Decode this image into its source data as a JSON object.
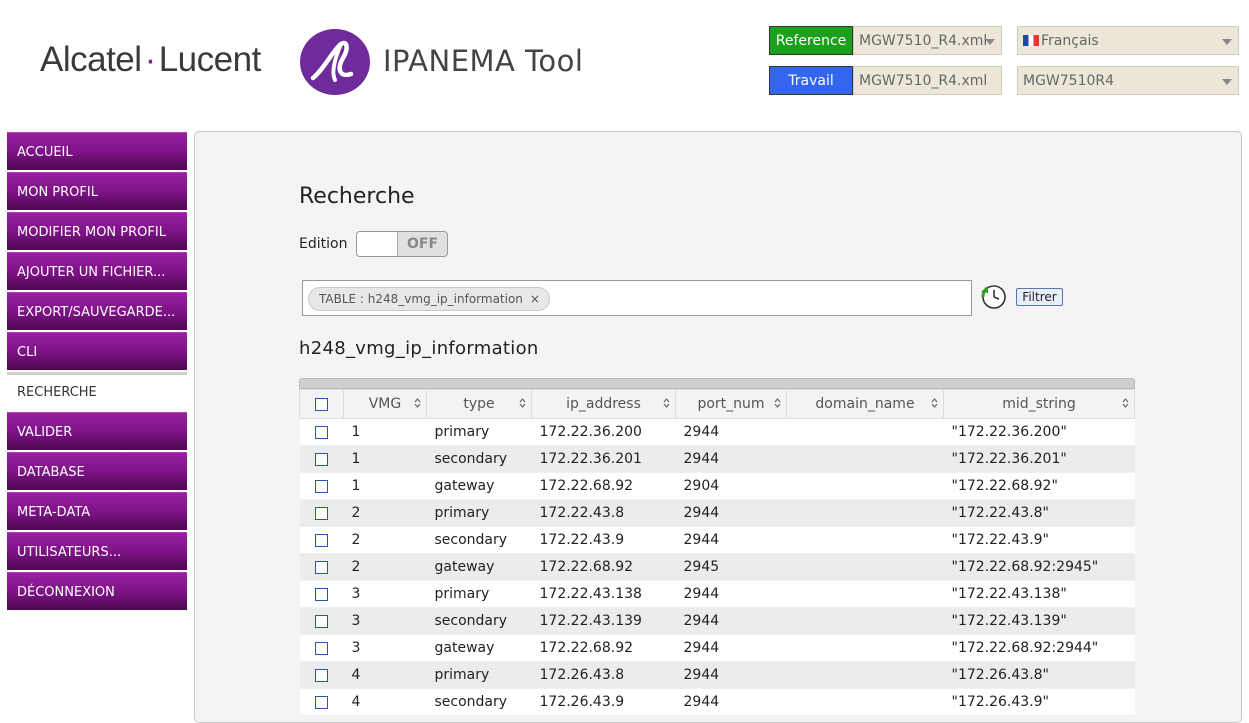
{
  "header": {
    "brand_left": "Alcatel",
    "brand_dot": "·",
    "brand_right": "Lucent",
    "tool_name": "IPANEMA Tool",
    "reference_label": "Reference",
    "reference_value": "MGW7510_R4.xml",
    "work_label": "Travail",
    "work_file": "MGW7510_R4.xml",
    "language_value": "Français",
    "work_select_value": "MGW7510R4",
    "colors": {
      "reference_bg": "#1aa01a",
      "work_bg": "#3366ee",
      "accent": "#7b2a8e"
    }
  },
  "sidebar": {
    "items": [
      {
        "label": "ACCUEIL"
      },
      {
        "label": "MON PROFIL"
      },
      {
        "label": "MODIFIER MON PROFIL"
      },
      {
        "label": "AJOUTER UN FICHIER..."
      },
      {
        "label": "EXPORT/SAUVEGARDE..."
      },
      {
        "label": "CLI"
      },
      {
        "label": "RECHERCHE"
      },
      {
        "label": "VALIDER"
      },
      {
        "label": "DATABASE"
      },
      {
        "label": "META-DATA"
      },
      {
        "label": "UTILISATEURS..."
      },
      {
        "label": "DÉCONNEXION"
      }
    ],
    "active": "RECHERCHE"
  },
  "main": {
    "title": "Recherche",
    "edition_label": "Edition",
    "edition_state": "OFF",
    "filter_chip": "TABLE : h248_vmg_ip_information",
    "filter_chip_remove": "×",
    "filter_button": "Filtrer",
    "table_title": "h248_vmg_ip_information",
    "columns": [
      "VMG",
      "type",
      "ip_address",
      "port_num",
      "domain_name",
      "mid_string"
    ],
    "rows": [
      {
        "vmg": "1",
        "type": "primary",
        "ip": "172.22.36.200",
        "port": "2944",
        "domain": "",
        "mid": "\"172.22.36.200\""
      },
      {
        "vmg": "1",
        "type": "secondary",
        "ip": "172.22.36.201",
        "port": "2944",
        "domain": "",
        "mid": "\"172.22.36.201\""
      },
      {
        "vmg": "1",
        "type": "gateway",
        "ip": "172.22.68.92",
        "port": "2904",
        "domain": "",
        "mid": "\"172.22.68.92\""
      },
      {
        "vmg": "2",
        "type": "primary",
        "ip": "172.22.43.8",
        "port": "2944",
        "domain": "",
        "mid": "\"172.22.43.8\""
      },
      {
        "vmg": "2",
        "type": "secondary",
        "ip": "172.22.43.9",
        "port": "2944",
        "domain": "",
        "mid": "\"172.22.43.9\""
      },
      {
        "vmg": "2",
        "type": "gateway",
        "ip": "172.22.68.92",
        "port": "2945",
        "domain": "",
        "mid": "\"172.22.68.92:2945\""
      },
      {
        "vmg": "3",
        "type": "primary",
        "ip": "172.22.43.138",
        "port": "2944",
        "domain": "",
        "mid": "\"172.22.43.138\""
      },
      {
        "vmg": "3",
        "type": "secondary",
        "ip": "172.22.43.139",
        "port": "2944",
        "domain": "",
        "mid": "\"172.22.43.139\""
      },
      {
        "vmg": "3",
        "type": "gateway",
        "ip": "172.22.68.92",
        "port": "2944",
        "domain": "",
        "mid": "\"172.22.68.92:2944\""
      },
      {
        "vmg": "4",
        "type": "primary",
        "ip": "172.26.43.8",
        "port": "2944",
        "domain": "",
        "mid": "\"172.26.43.8\""
      },
      {
        "vmg": "4",
        "type": "secondary",
        "ip": "172.26.43.9",
        "port": "2944",
        "domain": "",
        "mid": "\"172.26.43.9\""
      }
    ]
  }
}
